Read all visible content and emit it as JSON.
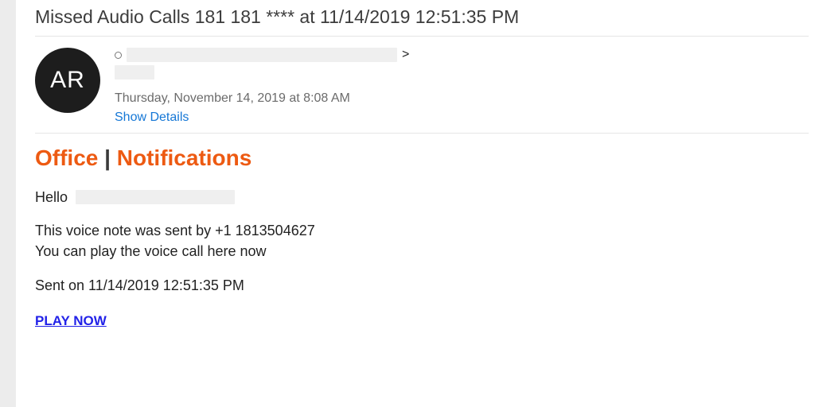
{
  "subject": "Missed Audio Calls 181 181 **** at 11/14/2019 12:51:35 PM",
  "avatar": {
    "initials": "AR"
  },
  "from_line": {
    "trailing": ">"
  },
  "date": "Thursday, November 14, 2019 at 8:08 AM",
  "show_details": "Show Details",
  "body": {
    "brand_left": "Office",
    "brand_sep": " | ",
    "brand_right": "Notifications",
    "hello": "Hello",
    "line1": "This voice note was sent by +1 1813504627",
    "line2": "You can play the voice call here now",
    "sent": "Sent on 11/14/2019 12:51:35 PM",
    "cta": "PLAY NOW"
  }
}
